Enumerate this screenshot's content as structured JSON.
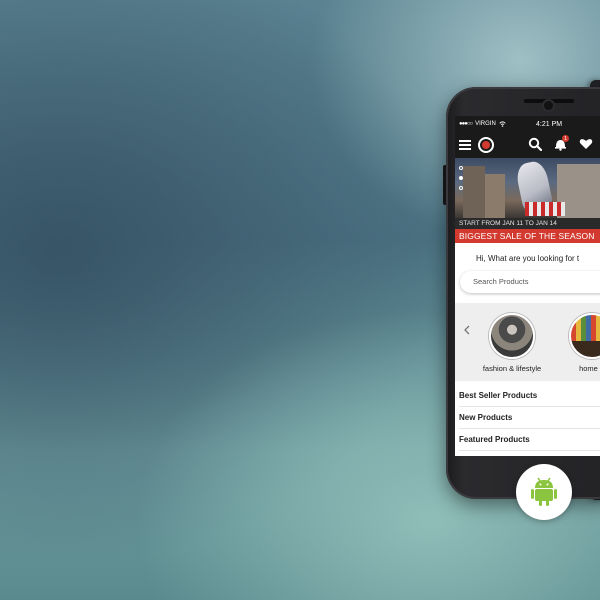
{
  "status_bar": {
    "carrier": "VIRGIN",
    "time": "4:21 PM"
  },
  "app_bar": {
    "notification_count": "1"
  },
  "banner": {
    "promo_dates": "START FROM JAN 11 TO JAN 14",
    "promo_headline": "BIGGEST SALE OF THE SEASON"
  },
  "greeting": "Hi, What are you looking for t",
  "search": {
    "placeholder": "Search Products"
  },
  "categories": [
    {
      "label": "fashion & lifestyle"
    },
    {
      "label": "home &"
    }
  ],
  "product_links": [
    {
      "label": "Best Seller Products"
    },
    {
      "label": "New Products"
    },
    {
      "label": "Featured Products"
    }
  ],
  "colors": {
    "accent_red": "#d33a2f",
    "app_bar": "#1a1a1a",
    "android_green": "#8bc43f"
  },
  "icons": [
    "menu-icon",
    "search-icon",
    "bell-icon",
    "heart-icon",
    "chevron-left-icon",
    "android-icon"
  ]
}
